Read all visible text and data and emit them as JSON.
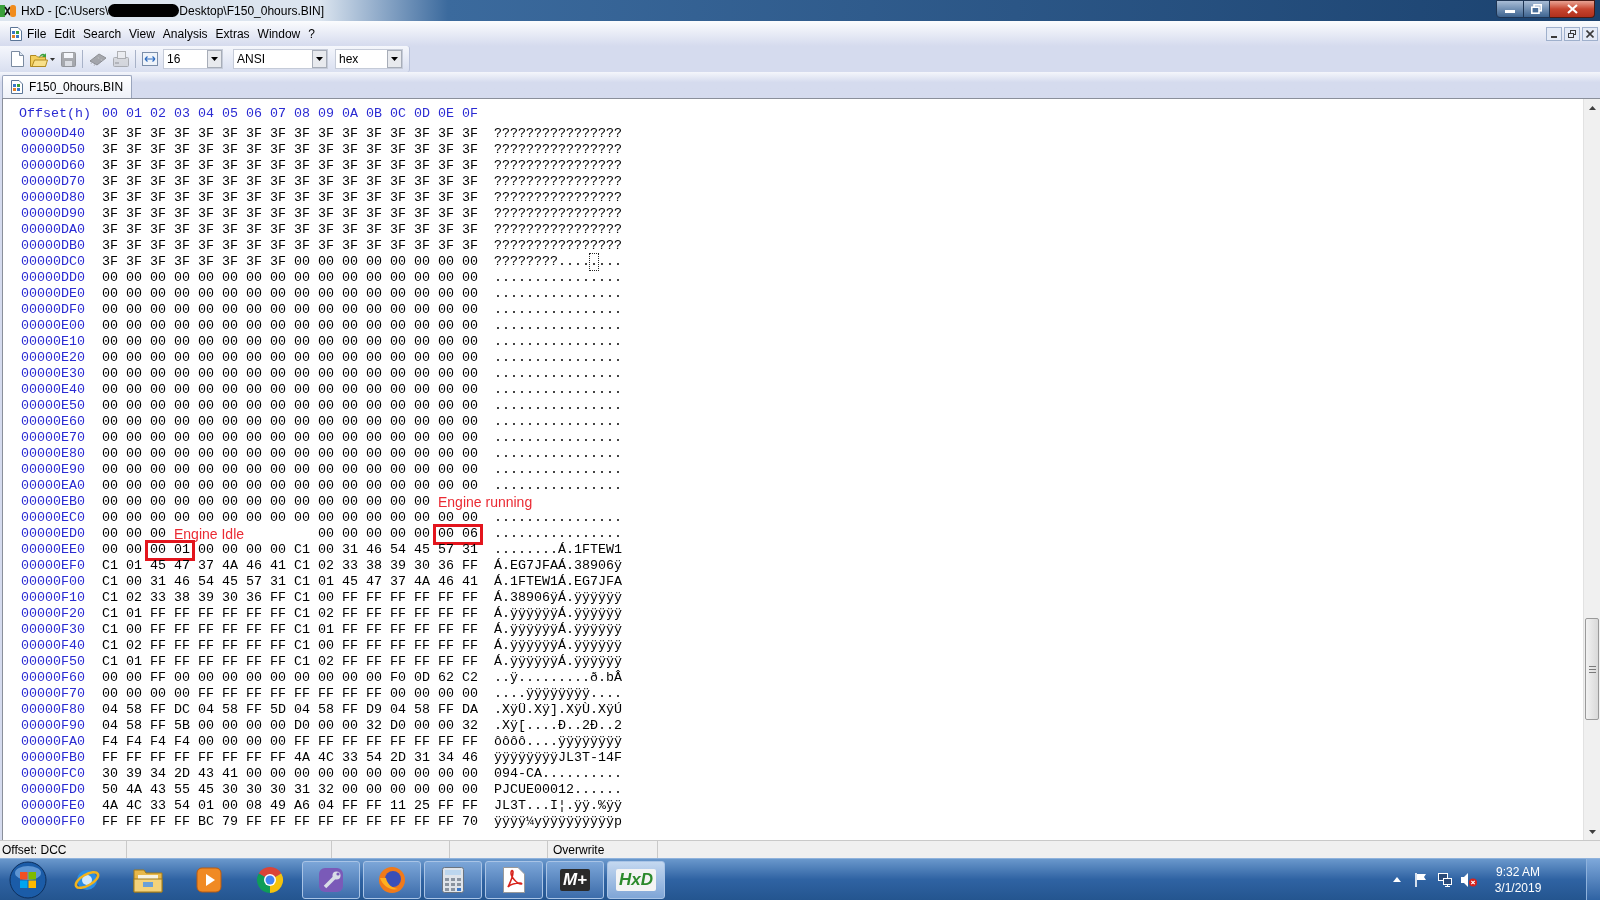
{
  "window": {
    "title_start": "HxD - [C:\\Users\\",
    "redacted": true,
    "title_end": "Desktop\\F150_0hours.BIN]"
  },
  "menu": [
    "File",
    "Edit",
    "Search",
    "View",
    "Analysis",
    "Extras",
    "Window",
    "?"
  ],
  "toolbar": {
    "buttons": [
      {
        "disabled": false
      },
      {
        "disabled": false
      },
      {
        "disabled": true
      },
      {
        "disabled": true
      },
      {
        "disabled": true
      }
    ],
    "bytes_per_row": "16",
    "charset": "ANSI",
    "offset_base": "hex"
  },
  "tabs": [
    {
      "label": "F150_0hours.BIN",
      "selected": true
    }
  ],
  "hex_view": {
    "offset_header": "Offset(h)",
    "columns": [
      "00",
      "01",
      "02",
      "03",
      "04",
      "05",
      "06",
      "07",
      "08",
      "09",
      "0A",
      "0B",
      "0C",
      "0D",
      "0E",
      "0F"
    ],
    "rows": [
      {
        "offset": "00000D40",
        "bytes": [
          "3F",
          "3F",
          "3F",
          "3F",
          "3F",
          "3F",
          "3F",
          "3F",
          "3F",
          "3F",
          "3F",
          "3F",
          "3F",
          "3F",
          "3F",
          "3F"
        ],
        "text": "????????????????"
      },
      {
        "offset": "00000D50",
        "bytes": [
          "3F",
          "3F",
          "3F",
          "3F",
          "3F",
          "3F",
          "3F",
          "3F",
          "3F",
          "3F",
          "3F",
          "3F",
          "3F",
          "3F",
          "3F",
          "3F"
        ],
        "text": "????????????????"
      },
      {
        "offset": "00000D60",
        "bytes": [
          "3F",
          "3F",
          "3F",
          "3F",
          "3F",
          "3F",
          "3F",
          "3F",
          "3F",
          "3F",
          "3F",
          "3F",
          "3F",
          "3F",
          "3F",
          "3F"
        ],
        "text": "????????????????"
      },
      {
        "offset": "00000D70",
        "bytes": [
          "3F",
          "3F",
          "3F",
          "3F",
          "3F",
          "3F",
          "3F",
          "3F",
          "3F",
          "3F",
          "3F",
          "3F",
          "3F",
          "3F",
          "3F",
          "3F"
        ],
        "text": "????????????????"
      },
      {
        "offset": "00000D80",
        "bytes": [
          "3F",
          "3F",
          "3F",
          "3F",
          "3F",
          "3F",
          "3F",
          "3F",
          "3F",
          "3F",
          "3F",
          "3F",
          "3F",
          "3F",
          "3F",
          "3F"
        ],
        "text": "????????????????"
      },
      {
        "offset": "00000D90",
        "bytes": [
          "3F",
          "3F",
          "3F",
          "3F",
          "3F",
          "3F",
          "3F",
          "3F",
          "3F",
          "3F",
          "3F",
          "3F",
          "3F",
          "3F",
          "3F",
          "3F"
        ],
        "text": "????????????????"
      },
      {
        "offset": "00000DA0",
        "bytes": [
          "3F",
          "3F",
          "3F",
          "3F",
          "3F",
          "3F",
          "3F",
          "3F",
          "3F",
          "3F",
          "3F",
          "3F",
          "3F",
          "3F",
          "3F",
          "3F"
        ],
        "text": "????????????????"
      },
      {
        "offset": "00000DB0",
        "bytes": [
          "3F",
          "3F",
          "3F",
          "3F",
          "3F",
          "3F",
          "3F",
          "3F",
          "3F",
          "3F",
          "3F",
          "3F",
          "3F",
          "3F",
          "3F",
          "3F"
        ],
        "text": "????????????????"
      },
      {
        "offset": "00000DC0",
        "bytes": [
          "3F",
          "3F",
          "3F",
          "3F",
          "3F",
          "3F",
          "3F",
          "3F",
          "00",
          "00",
          "00",
          "00",
          "00",
          "00",
          "00",
          "00"
        ],
        "text_parts": [
          {
            "text": "????????....",
            "cursor": false
          },
          {
            "text": ".",
            "cursor": true
          },
          {
            "text": "...",
            "cursor": false
          }
        ]
      },
      {
        "offset": "00000DD0",
        "bytes": [
          "00",
          "00",
          "00",
          "00",
          "00",
          "00",
          "00",
          "00",
          "00",
          "00",
          "00",
          "00",
          "00",
          "00",
          "00",
          "00"
        ],
        "text": "................"
      },
      {
        "offset": "00000DE0",
        "bytes": [
          "00",
          "00",
          "00",
          "00",
          "00",
          "00",
          "00",
          "00",
          "00",
          "00",
          "00",
          "00",
          "00",
          "00",
          "00",
          "00"
        ],
        "text": "................"
      },
      {
        "offset": "00000DF0",
        "bytes": [
          "00",
          "00",
          "00",
          "00",
          "00",
          "00",
          "00",
          "00",
          "00",
          "00",
          "00",
          "00",
          "00",
          "00",
          "00",
          "00"
        ],
        "text": "................"
      },
      {
        "offset": "00000E00",
        "bytes": [
          "00",
          "00",
          "00",
          "00",
          "00",
          "00",
          "00",
          "00",
          "00",
          "00",
          "00",
          "00",
          "00",
          "00",
          "00",
          "00"
        ],
        "text": "................"
      },
      {
        "offset": "00000E10",
        "bytes": [
          "00",
          "00",
          "00",
          "00",
          "00",
          "00",
          "00",
          "00",
          "00",
          "00",
          "00",
          "00",
          "00",
          "00",
          "00",
          "00"
        ],
        "text": "................"
      },
      {
        "offset": "00000E20",
        "bytes": [
          "00",
          "00",
          "00",
          "00",
          "00",
          "00",
          "00",
          "00",
          "00",
          "00",
          "00",
          "00",
          "00",
          "00",
          "00",
          "00"
        ],
        "text": "................"
      },
      {
        "offset": "00000E30",
        "bytes": [
          "00",
          "00",
          "00",
          "00",
          "00",
          "00",
          "00",
          "00",
          "00",
          "00",
          "00",
          "00",
          "00",
          "00",
          "00",
          "00"
        ],
        "text": "................"
      },
      {
        "offset": "00000E40",
        "bytes": [
          "00",
          "00",
          "00",
          "00",
          "00",
          "00",
          "00",
          "00",
          "00",
          "00",
          "00",
          "00",
          "00",
          "00",
          "00",
          "00"
        ],
        "text": "................"
      },
      {
        "offset": "00000E50",
        "bytes": [
          "00",
          "00",
          "00",
          "00",
          "00",
          "00",
          "00",
          "00",
          "00",
          "00",
          "00",
          "00",
          "00",
          "00",
          "00",
          "00"
        ],
        "text": "................"
      },
      {
        "offset": "00000E60",
        "bytes": [
          "00",
          "00",
          "00",
          "00",
          "00",
          "00",
          "00",
          "00",
          "00",
          "00",
          "00",
          "00",
          "00",
          "00",
          "00",
          "00"
        ],
        "text": "................"
      },
      {
        "offset": "00000E70",
        "bytes": [
          "00",
          "00",
          "00",
          "00",
          "00",
          "00",
          "00",
          "00",
          "00",
          "00",
          "00",
          "00",
          "00",
          "00",
          "00",
          "00"
        ],
        "text": "................"
      },
      {
        "offset": "00000E80",
        "bytes": [
          "00",
          "00",
          "00",
          "00",
          "00",
          "00",
          "00",
          "00",
          "00",
          "00",
          "00",
          "00",
          "00",
          "00",
          "00",
          "00"
        ],
        "text": "................"
      },
      {
        "offset": "00000E90",
        "bytes": [
          "00",
          "00",
          "00",
          "00",
          "00",
          "00",
          "00",
          "00",
          "00",
          "00",
          "00",
          "00",
          "00",
          "00",
          "00",
          "00"
        ],
        "text": "................"
      },
      {
        "offset": "00000EA0",
        "bytes": [
          "00",
          "00",
          "00",
          "00",
          "00",
          "00",
          "00",
          "00",
          "00",
          "00",
          "00",
          "00",
          "00",
          "00",
          "00",
          "00"
        ],
        "text": "................"
      },
      {
        "offset": "00000EB0",
        "segments": [
          {
            "kind": "bytes",
            "values": [
              "00",
              "00",
              "00",
              "00",
              "00",
              "00",
              "00",
              "00",
              "00",
              "00",
              "00",
              "00",
              "00",
              "00"
            ]
          },
          {
            "kind": "note",
            "text": "Engine running"
          }
        ]
      },
      {
        "offset": "00000EC0",
        "bytes": [
          "00",
          "00",
          "00",
          "00",
          "00",
          "00",
          "00",
          "00",
          "00",
          "00",
          "00",
          "00",
          "00",
          "00",
          "00",
          "00"
        ],
        "text": "................"
      },
      {
        "offset": "00000ED0",
        "segments": [
          {
            "kind": "bytes",
            "values": [
              "00",
              "00",
              "00"
            ]
          },
          {
            "kind": "note",
            "text": "Engine Idle"
          },
          {
            "kind": "bytes",
            "values": [
              "00",
              "00",
              "00",
              "00",
              "00"
            ]
          },
          {
            "kind": "highlight",
            "values": [
              "00",
              "06"
            ]
          }
        ],
        "text": "................"
      },
      {
        "offset": "00000EE0",
        "segments": [
          {
            "kind": "bytes",
            "values": [
              "00",
              "00"
            ]
          },
          {
            "kind": "highlight",
            "values": [
              "00",
              "01"
            ]
          },
          {
            "kind": "bytes",
            "values": [
              "00",
              "00",
              "00",
              "00",
              "C1",
              "00",
              "31",
              "46",
              "54",
              "45",
              "57",
              "31"
            ]
          }
        ],
        "text": "........Á.1FTEW1"
      },
      {
        "offset": "00000EF0",
        "bytes": [
          "C1",
          "01",
          "45",
          "47",
          "37",
          "4A",
          "46",
          "41",
          "C1",
          "02",
          "33",
          "38",
          "39",
          "30",
          "36",
          "FF"
        ],
        "text": "Á.EG7JFAÁ.38906ÿ"
      },
      {
        "offset": "00000F00",
        "bytes": [
          "C1",
          "00",
          "31",
          "46",
          "54",
          "45",
          "57",
          "31",
          "C1",
          "01",
          "45",
          "47",
          "37",
          "4A",
          "46",
          "41"
        ],
        "text": "Á.1FTEW1Á.EG7JFA"
      },
      {
        "offset": "00000F10",
        "bytes": [
          "C1",
          "02",
          "33",
          "38",
          "39",
          "30",
          "36",
          "FF",
          "C1",
          "00",
          "FF",
          "FF",
          "FF",
          "FF",
          "FF",
          "FF"
        ],
        "text": "Á.38906ÿÁ.ÿÿÿÿÿÿ"
      },
      {
        "offset": "00000F20",
        "bytes": [
          "C1",
          "01",
          "FF",
          "FF",
          "FF",
          "FF",
          "FF",
          "FF",
          "C1",
          "02",
          "FF",
          "FF",
          "FF",
          "FF",
          "FF",
          "FF"
        ],
        "text": "Á.ÿÿÿÿÿÿÁ.ÿÿÿÿÿÿ"
      },
      {
        "offset": "00000F30",
        "bytes": [
          "C1",
          "00",
          "FF",
          "FF",
          "FF",
          "FF",
          "FF",
          "FF",
          "C1",
          "01",
          "FF",
          "FF",
          "FF",
          "FF",
          "FF",
          "FF"
        ],
        "text": "Á.ÿÿÿÿÿÿÁ.ÿÿÿÿÿÿ"
      },
      {
        "offset": "00000F40",
        "bytes": [
          "C1",
          "02",
          "FF",
          "FF",
          "FF",
          "FF",
          "FF",
          "FF",
          "C1",
          "00",
          "FF",
          "FF",
          "FF",
          "FF",
          "FF",
          "FF"
        ],
        "text": "Á.ÿÿÿÿÿÿÁ.ÿÿÿÿÿÿ"
      },
      {
        "offset": "00000F50",
        "bytes": [
          "C1",
          "01",
          "FF",
          "FF",
          "FF",
          "FF",
          "FF",
          "FF",
          "C1",
          "02",
          "FF",
          "FF",
          "FF",
          "FF",
          "FF",
          "FF"
        ],
        "text": "Á.ÿÿÿÿÿÿÁ.ÿÿÿÿÿÿ"
      },
      {
        "offset": "00000F60",
        "bytes": [
          "00",
          "00",
          "FF",
          "00",
          "00",
          "00",
          "00",
          "00",
          "00",
          "00",
          "00",
          "00",
          "F0",
          "0D",
          "62",
          "C2"
        ],
        "text": "..ÿ.........ð.bÂ"
      },
      {
        "offset": "00000F70",
        "bytes": [
          "00",
          "00",
          "00",
          "00",
          "FF",
          "FF",
          "FF",
          "FF",
          "FF",
          "FF",
          "FF",
          "FF",
          "00",
          "00",
          "00",
          "00"
        ],
        "text": "....ÿÿÿÿÿÿÿÿ...."
      },
      {
        "offset": "00000F80",
        "bytes": [
          "04",
          "58",
          "FF",
          "DC",
          "04",
          "58",
          "FF",
          "5D",
          "04",
          "58",
          "FF",
          "D9",
          "04",
          "58",
          "FF",
          "DA"
        ],
        "text": ".XÿÜ.Xÿ].XÿÙ.XÿÚ"
      },
      {
        "offset": "00000F90",
        "bytes": [
          "04",
          "58",
          "FF",
          "5B",
          "00",
          "00",
          "00",
          "00",
          "D0",
          "00",
          "00",
          "32",
          "D0",
          "00",
          "00",
          "32"
        ],
        "text": ".Xÿ[....Ð..2Ð..2"
      },
      {
        "offset": "00000FA0",
        "bytes": [
          "F4",
          "F4",
          "F4",
          "F4",
          "00",
          "00",
          "00",
          "00",
          "FF",
          "FF",
          "FF",
          "FF",
          "FF",
          "FF",
          "FF",
          "FF"
        ],
        "text": "ôôôô....ÿÿÿÿÿÿÿÿ"
      },
      {
        "offset": "00000FB0",
        "bytes": [
          "FF",
          "FF",
          "FF",
          "FF",
          "FF",
          "FF",
          "FF",
          "FF",
          "4A",
          "4C",
          "33",
          "54",
          "2D",
          "31",
          "34",
          "46"
        ],
        "text": "ÿÿÿÿÿÿÿÿJL3T-14F"
      },
      {
        "offset": "00000FC0",
        "bytes": [
          "30",
          "39",
          "34",
          "2D",
          "43",
          "41",
          "00",
          "00",
          "00",
          "00",
          "00",
          "00",
          "00",
          "00",
          "00",
          "00"
        ],
        "text": "094-CA.........."
      },
      {
        "offset": "00000FD0",
        "bytes": [
          "50",
          "4A",
          "43",
          "55",
          "45",
          "30",
          "30",
          "30",
          "31",
          "32",
          "00",
          "00",
          "00",
          "00",
          "00",
          "00"
        ],
        "text": "PJCUE00012......"
      },
      {
        "offset": "00000FE0",
        "bytes": [
          "4A",
          "4C",
          "33",
          "54",
          "01",
          "00",
          "08",
          "49",
          "A6",
          "04",
          "FF",
          "FF",
          "11",
          "25",
          "FF",
          "FF"
        ],
        "text": "JL3T...I¦.ÿÿ.%ÿÿ"
      },
      {
        "offset": "00000FF0",
        "bytes": [
          "FF",
          "FF",
          "FF",
          "FF",
          "BC",
          "79",
          "FF",
          "FF",
          "FF",
          "FF",
          "FF",
          "FF",
          "FF",
          "FF",
          "FF",
          "70"
        ],
        "text": "ÿÿÿÿ¼yÿÿÿÿÿÿÿÿÿp"
      }
    ]
  },
  "status_bar": {
    "offset": "Offset: DCC",
    "mode": "Overwrite"
  },
  "taskbar": {
    "buttons": [
      {
        "running": false,
        "selected": false
      },
      {
        "running": false,
        "selected": false
      },
      {
        "running": false,
        "selected": false
      },
      {
        "running": false,
        "selected": false
      },
      {
        "running": true,
        "selected": false
      },
      {
        "running": true,
        "selected": false
      },
      {
        "running": true,
        "selected": false
      },
      {
        "running": true,
        "selected": false
      },
      {
        "running": true,
        "selected": false,
        "label": "M+"
      },
      {
        "running": true,
        "selected": true,
        "label": "HxD"
      }
    ],
    "clock": {
      "time": "9:32 AM",
      "date": "3/1/2019"
    }
  }
}
